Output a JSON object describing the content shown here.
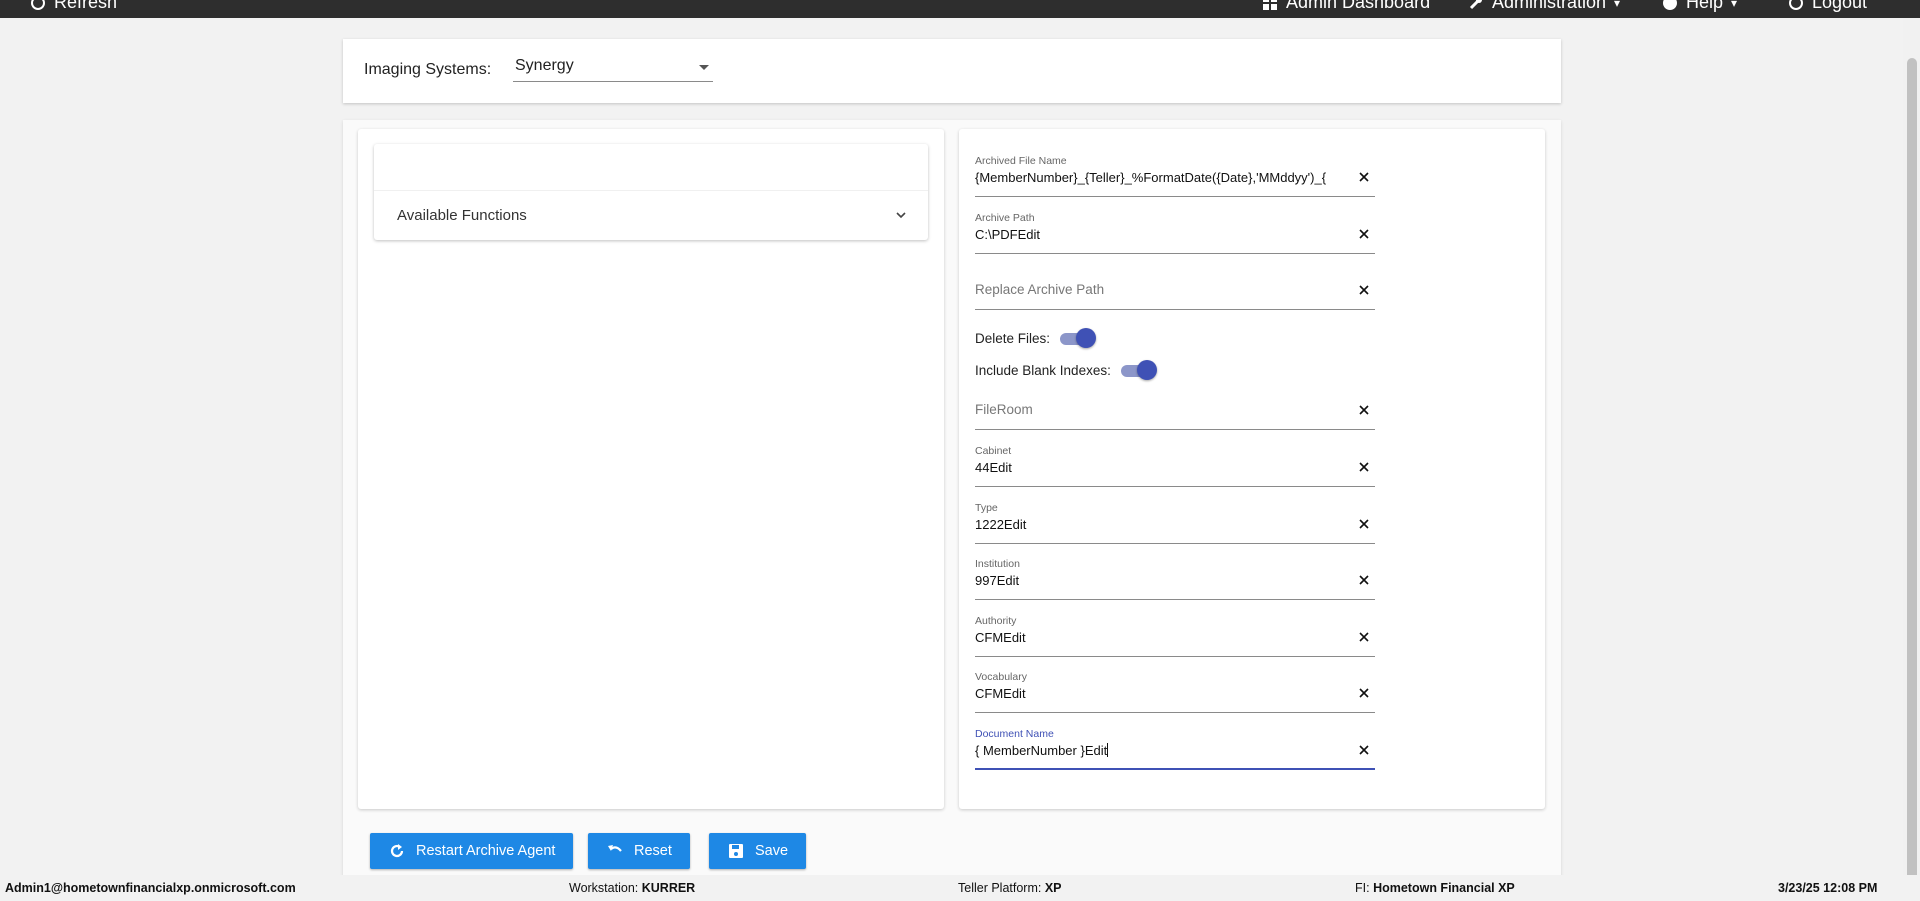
{
  "topbar": {
    "refresh_label": "Refresh",
    "admin_dashboard_label": "Admin Dashboard",
    "administration_label": "Administration",
    "help_label": "Help",
    "logout_label": "Logout"
  },
  "imaging": {
    "label": "Imaging Systems:",
    "selected": "Synergy"
  },
  "functions": {
    "header": "Available Functions"
  },
  "fields": {
    "archived_file_name": {
      "label": "Archived File Name",
      "value": "{MemberNumber}_{Teller}_%FormatDate({Date},'MMddyy')_{"
    },
    "archive_path": {
      "label": "Archive Path",
      "value": "C:\\PDFEdit"
    },
    "replace_archive_path": {
      "placeholder": "Replace Archive Path"
    },
    "fileroom": {
      "placeholder": "FileRoom"
    },
    "cabinet": {
      "label": "Cabinet",
      "value": "44Edit"
    },
    "type": {
      "label": "Type",
      "value": "1222Edit"
    },
    "institution": {
      "label": "Institution",
      "value": "997Edit"
    },
    "authority": {
      "label": "Authority",
      "value": "CFMEdit"
    },
    "vocabulary": {
      "label": "Vocabulary",
      "value": "CFMEdit"
    },
    "document_name": {
      "label": "Document Name",
      "value": "{ MemberNumber }Edit"
    }
  },
  "toggles": {
    "delete_files": {
      "label": "Delete Files:",
      "on": true
    },
    "include_blank_indexes": {
      "label": "Include Blank Indexes:",
      "on": true
    }
  },
  "buttons": {
    "restart": "Restart Archive Agent",
    "reset": "Reset",
    "save": "Save"
  },
  "footer": {
    "user": "Admin1@hometownfinancialxp.onmicrosoft.com",
    "workstation_label": "Workstation:",
    "workstation_value": "KURRER",
    "teller_label": "Teller Platform:",
    "teller_value": "XP",
    "fi_label": "FI:",
    "fi_value": "Hometown Financial XP",
    "datetime": "3/23/25 12:08 PM"
  },
  "colors": {
    "accent": "#3f51b5",
    "button": "#1e88e5",
    "topbar": "#2e2e2e"
  }
}
